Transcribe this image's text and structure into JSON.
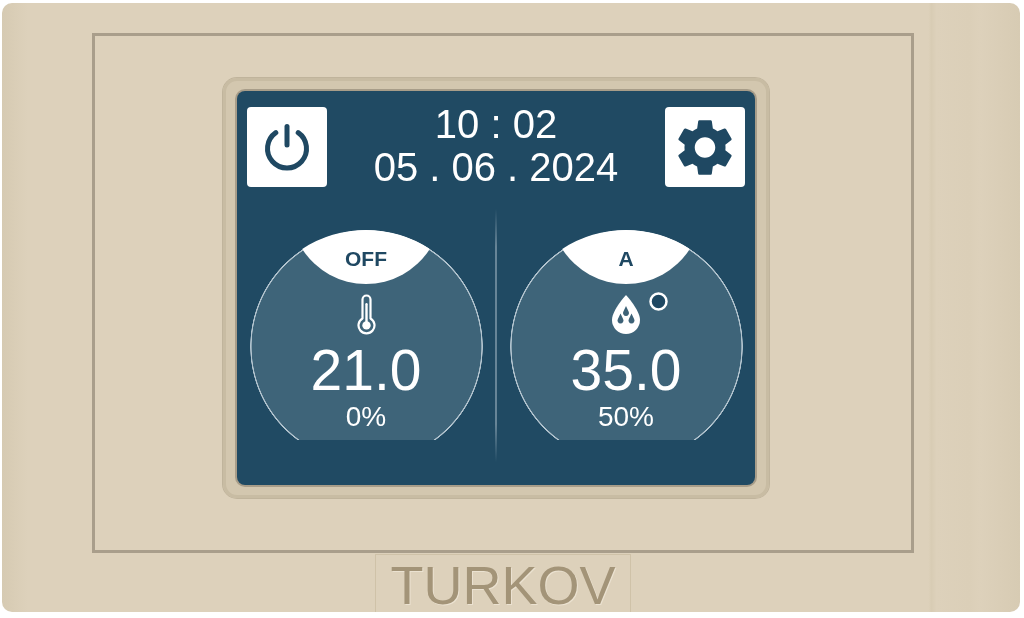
{
  "clock": {
    "time": "10 : 02",
    "date": "05 . 06 . 2024"
  },
  "zones": [
    {
      "kind": "temperature",
      "mode": "OFF",
      "value": "21.0",
      "output": "0%",
      "status_ring": false
    },
    {
      "kind": "humidity",
      "mode": "A",
      "value": "35.0",
      "output": "50%",
      "status_ring": true
    }
  ],
  "brand_logo": "TURKOV"
}
